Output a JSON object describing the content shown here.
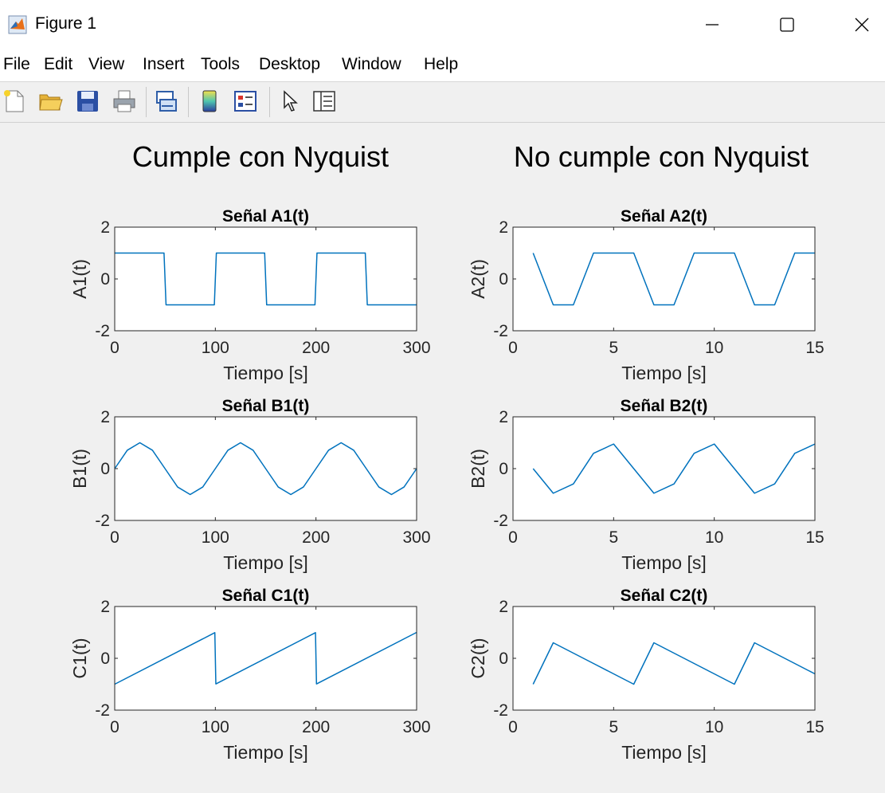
{
  "window": {
    "title": "Figure 1",
    "icon": "matlab-icon",
    "controls": [
      "minimize-icon",
      "maximize-icon",
      "close-icon"
    ]
  },
  "menu": [
    "File",
    "Edit",
    "View",
    "Insert",
    "Tools",
    "Desktop",
    "Window",
    "Help"
  ],
  "toolbar": [
    "new-figure-icon",
    "open-file-icon",
    "save-icon",
    "print-icon",
    "link-plot-icon",
    "insert-colorbar-icon",
    "insert-legend-icon",
    "edit-plot-icon",
    "open-property-inspector-icon"
  ],
  "figure": {
    "left_title": "Cumple con Nyquist",
    "right_title": "No cumple con Nyquist",
    "line_color": "#0072BD"
  },
  "chart_data": [
    {
      "type": "line",
      "title": "Señal A1(t)",
      "xlabel": "Tiempo [s]",
      "ylabel": "A1(t)",
      "xlim": [
        0,
        300
      ],
      "ylim": [
        -2,
        2
      ],
      "xticks": [
        "0",
        "100",
        "200",
        "300"
      ],
      "yticks": [
        "-2",
        "0",
        "2"
      ],
      "x": [
        0,
        49,
        51,
        99,
        101,
        149,
        151,
        199,
        201,
        249,
        251,
        300
      ],
      "y": [
        1,
        1,
        -1,
        -1,
        1,
        1,
        -1,
        -1,
        1,
        1,
        -1,
        -1
      ]
    },
    {
      "type": "line",
      "title": "Señal A2(t)",
      "xlabel": "Tiempo [s]",
      "ylabel": "A2(t)",
      "xlim": [
        0,
        15
      ],
      "ylim": [
        -2,
        2
      ],
      "xticks": [
        "0",
        "5",
        "10",
        "15"
      ],
      "yticks": [
        "-2",
        "0",
        "2"
      ],
      "x": [
        1,
        2,
        3,
        4,
        5,
        6,
        7,
        8,
        9,
        10,
        11,
        12,
        13,
        14,
        15
      ],
      "y": [
        1,
        -1,
        -1,
        1,
        1,
        1,
        -1,
        -1,
        1,
        1,
        1,
        -1,
        -1,
        1,
        1
      ]
    },
    {
      "type": "line",
      "title": "Señal B1(t)",
      "xlabel": "Tiempo [s]",
      "ylabel": "B1(t)",
      "xlim": [
        0,
        300
      ],
      "ylim": [
        -2,
        2
      ],
      "xticks": [
        "0",
        "100",
        "200",
        "300"
      ],
      "yticks": [
        "-2",
        "0",
        "2"
      ],
      "x": [
        0,
        12.5,
        25,
        37.5,
        50,
        62.5,
        75,
        87.5,
        100,
        112.5,
        125,
        137.5,
        150,
        162.5,
        175,
        187.5,
        200,
        212.5,
        225,
        237.5,
        250,
        262.5,
        275,
        287.5,
        300
      ],
      "y": [
        0,
        0.71,
        1,
        0.71,
        0,
        -0.71,
        -1,
        -0.71,
        0,
        0.71,
        1,
        0.71,
        0,
        -0.71,
        -1,
        -0.71,
        0,
        0.71,
        1,
        0.71,
        0,
        -0.71,
        -1,
        -0.71,
        0
      ]
    },
    {
      "type": "line",
      "title": "Señal B2(t)",
      "xlabel": "Tiempo [s]",
      "ylabel": "B2(t)",
      "xlim": [
        0,
        15
      ],
      "ylim": [
        -2,
        2
      ],
      "xticks": [
        "0",
        "5",
        "10",
        "15"
      ],
      "yticks": [
        "-2",
        "0",
        "2"
      ],
      "x": [
        1,
        2,
        3,
        4,
        5,
        6,
        7,
        8,
        9,
        10,
        11,
        12,
        13,
        14,
        15
      ],
      "y": [
        0,
        -0.95,
        -0.59,
        0.59,
        0.95,
        0,
        -0.95,
        -0.59,
        0.59,
        0.95,
        0,
        -0.95,
        -0.59,
        0.59,
        0.95
      ]
    },
    {
      "type": "line",
      "title": "Señal C1(t)",
      "xlabel": "Tiempo [s]",
      "ylabel": "C1(t)",
      "xlim": [
        0,
        300
      ],
      "ylim": [
        -2,
        2
      ],
      "xticks": [
        "0",
        "100",
        "200",
        "300"
      ],
      "yticks": [
        "-2",
        "0",
        "2"
      ],
      "x": [
        0,
        99.5,
        100.5,
        199.5,
        200.5,
        300
      ],
      "y": [
        -1,
        0.99,
        -0.99,
        0.99,
        -0.99,
        1
      ]
    },
    {
      "type": "line",
      "title": "Señal C2(t)",
      "xlabel": "Tiempo [s]",
      "ylabel": "C2(t)",
      "xlim": [
        0,
        15
      ],
      "ylim": [
        -2,
        2
      ],
      "xticks": [
        "0",
        "5",
        "10",
        "15"
      ],
      "yticks": [
        "-2",
        "0",
        "2"
      ],
      "x": [
        1,
        2,
        3,
        4,
        5,
        6,
        7,
        8,
        9,
        10,
        11,
        12,
        13,
        14,
        15
      ],
      "y": [
        -1,
        0.6,
        0.2,
        -0.2,
        -0.6,
        -1,
        0.6,
        0.2,
        -0.2,
        -0.6,
        -1,
        0.6,
        0.2,
        -0.2,
        -0.6
      ]
    }
  ]
}
